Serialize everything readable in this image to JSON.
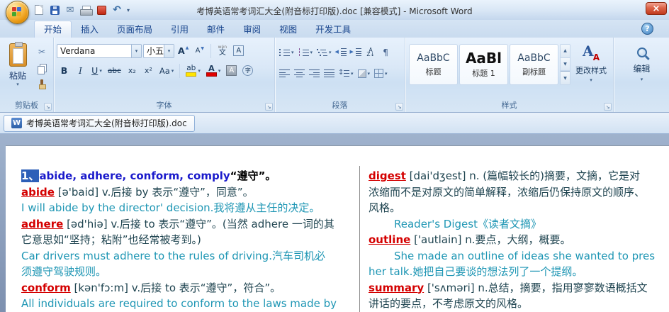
{
  "window": {
    "title": "考博英语常考词汇大全(附音标打印版).doc [兼容模式] - Microsoft Word"
  },
  "ribbon_tabs": [
    {
      "id": "home",
      "label": "开始",
      "active": true
    },
    {
      "id": "insert",
      "label": "插入"
    },
    {
      "id": "page-layout",
      "label": "页面布局"
    },
    {
      "id": "references",
      "label": "引用"
    },
    {
      "id": "mailings",
      "label": "邮件"
    },
    {
      "id": "review",
      "label": "审阅"
    },
    {
      "id": "view",
      "label": "视图"
    },
    {
      "id": "developer",
      "label": "开发工具"
    }
  ],
  "ribbon": {
    "clipboard": {
      "group_label": "剪贴板",
      "paste_label": "粘贴"
    },
    "font": {
      "group_label": "字体",
      "font_name": "Verdana",
      "font_size": "小五"
    },
    "paragraph": {
      "group_label": "段落"
    },
    "styles": {
      "group_label": "样式",
      "gallery": [
        {
          "id": "heading",
          "preview": "AaBbC",
          "name": "标题"
        },
        {
          "id": "heading-1",
          "preview": "AaBl",
          "name": "标题 1",
          "big": true
        },
        {
          "id": "subtitle",
          "preview": "AaBbC",
          "name": "副标题"
        }
      ],
      "change_styles_label": "更改样式"
    },
    "editing": {
      "button_label": "编辑"
    }
  },
  "doc_tab": {
    "title": "考博英语常考词汇大全(附音标打印版).doc"
  },
  "document": {
    "left_column": [
      {
        "seg": [
          {
            "t": "1、",
            "c": "sel"
          },
          {
            "t": "abide, adhere, conform, comply",
            "c": "head"
          },
          {
            "t": "“遵守”。",
            "c": "hb"
          }
        ]
      },
      {
        "seg": [
          {
            "t": "abide",
            "c": "word"
          },
          {
            "t": " [ə'baid] v.后接 by 表示“遵守”，同意”。",
            "c": "def"
          }
        ]
      },
      {
        "seg": [
          {
            "t": "I will abide by the director' decision.我将遵从主任的决定。",
            "c": "ex"
          }
        ]
      },
      {
        "seg": [
          {
            "t": "adhere",
            "c": "word"
          },
          {
            "t": " [əd'hiə] v.后接 to 表示“遵守”。(当然 adhere 一词的其",
            "c": "def"
          }
        ]
      },
      {
        "seg": [
          {
            "t": "它意思如“坚持；粘附”也经常被考到。)",
            "c": "def"
          }
        ]
      },
      {
        "seg": [
          {
            "t": "Car drivers must adhere to the rules of driving.汽车司机必",
            "c": "ex"
          }
        ]
      },
      {
        "seg": [
          {
            "t": "须遵守驾驶规则。",
            "c": "ex"
          }
        ]
      },
      {
        "seg": [
          {
            "t": "conform",
            "c": "word"
          },
          {
            "t": " [kən'fɔ:m] v.后接 to 表示“遵守”，符合”。",
            "c": "def"
          }
        ]
      },
      {
        "seg": [
          {
            "t": "All individuals are required to conform to the laws made by",
            "c": "ex"
          }
        ]
      }
    ],
    "right_column": [
      {
        "seg": [
          {
            "t": "digest",
            "c": "word"
          },
          {
            "t": " [dai'dʒest] n. (篇幅较长的)摘要，文摘，它是对",
            "c": "def"
          }
        ]
      },
      {
        "seg": [
          {
            "t": "浓缩而不是对原文的简单解释，浓缩后仍保持原文的顺序、",
            "c": "def"
          }
        ]
      },
      {
        "seg": [
          {
            "t": "风格。",
            "c": "def"
          }
        ]
      },
      {
        "indent": true,
        "seg": [
          {
            "t": "Reader's Digest《读者文摘》",
            "c": "ex"
          }
        ]
      },
      {
        "seg": [
          {
            "t": "outline",
            "c": "word"
          },
          {
            "t": " ['autlain] n.要点，大纲，概要。",
            "c": "def"
          }
        ]
      },
      {
        "indent": true,
        "seg": [
          {
            "t": "She made an outline of ideas she wanted to pres",
            "c": "ex"
          }
        ]
      },
      {
        "seg": [
          {
            "t": "her talk.她把自己要谈的想法列了一个提纲。",
            "c": "ex"
          }
        ]
      },
      {
        "seg": [
          {
            "t": "summary",
            "c": "word"
          },
          {
            "t": " ['sʌməri] n.总结，摘要，指用寥寥数语概括文",
            "c": "def"
          }
        ]
      },
      {
        "seg": [
          {
            "t": "讲话的要点，不考虑原文的风格。",
            "c": "def"
          }
        ]
      }
    ]
  }
}
